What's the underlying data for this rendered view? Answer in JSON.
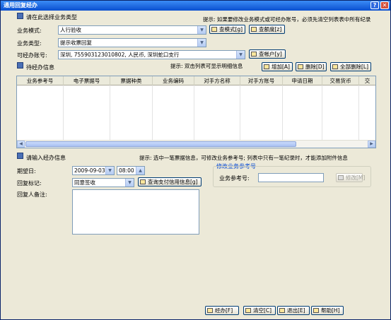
{
  "window": {
    "title": "通用回复经办",
    "help_glyph": "?",
    "close_glyph": "✕"
  },
  "sections": {
    "business_type": "请在此选择业务类型",
    "pending": "待经办信息",
    "input": "请输入经办信息"
  },
  "hints": {
    "top": "提示: 如果要修改业务模式或可经办账号，必须先清空列表表中所有纪录",
    "grid": "提示: 双击列表可显示明细信息",
    "input": "提示: 选中一笔票据信息，可修改业务参考号; 列表中只有一笔纪录时，才能添加附件信息"
  },
  "form": {
    "mode_label": "业务模式:",
    "mode_value": "人行验收",
    "type_label": "业务类型:",
    "type_value": "提示收票回复",
    "account_label": "可经办账号:",
    "account_value": "深圳, 755903123010802, 人民币, 深圳蛇口支行",
    "date_label": "期望日:",
    "date_value": "2009-09-03",
    "time_value": "08:00",
    "reply_label": "回复标记:",
    "reply_value": "同意签收",
    "remark_label": "回复人备注:",
    "ref_group_title": "修改业务参考号",
    "ref_label": "业务参考号:",
    "ref_value": ""
  },
  "buttons": {
    "view_mode": "查模式[g]",
    "view_limit": "查额度[z]",
    "view_account": "查帐户[y]",
    "add": "增加[A]",
    "delete": "删除[D]",
    "delete_all": "全部删除[L]",
    "query_credit": "查询支付信用信息[g]",
    "modify": "修改[M]",
    "submit": "经办[F]",
    "clear": "清空[C]",
    "exit": "退出[E]",
    "help": "帮助[H]"
  },
  "grid": {
    "columns": [
      "业务参考号",
      "电子票据号",
      "票据种类",
      "业务编码",
      "对手方名称",
      "对手方账号",
      "申请日期",
      "交易货币",
      "交"
    ],
    "rows": []
  },
  "colors": {
    "titlebar": "#0A4FD0",
    "window_bg": "#ECE9D8",
    "group_title": "#0046D5"
  }
}
